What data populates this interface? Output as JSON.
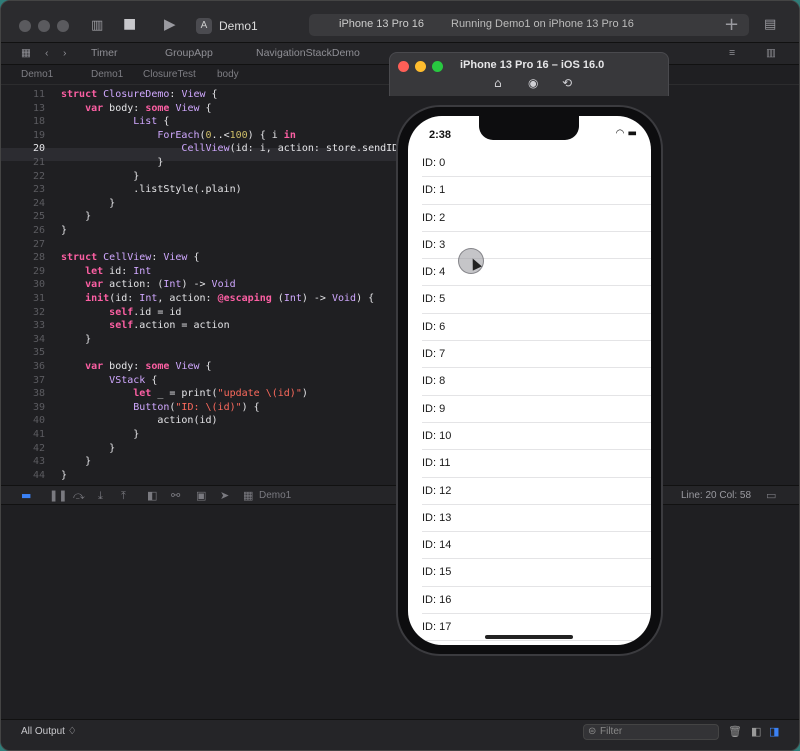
{
  "titlebar": {
    "app_name": "Demo1",
    "device": "iPhone 13 Pro 16",
    "status": "Running Demo1 on iPhone 13 Pro 16"
  },
  "tabs": [
    "Timer",
    "GroupApp",
    "NavigationStackDemo"
  ],
  "breadcrumb": [
    "Demo1",
    "Demo1",
    "ClosureTest",
    "body"
  ],
  "code": [
    {
      "n": "11",
      "t": "struct ClosureDemo: View {"
    },
    {
      "n": "13",
      "t": "    var body: some View {"
    },
    {
      "n": "18",
      "t": "            List {"
    },
    {
      "n": "19",
      "t": "                ForEach(0..<100) { i in"
    },
    {
      "n": "20",
      "t": "                    CellView(id: i, action: store.sendID)"
    },
    {
      "n": "21",
      "t": "                }"
    },
    {
      "n": "22",
      "t": "            }"
    },
    {
      "n": "23",
      "t": "            .listStyle(.plain)"
    },
    {
      "n": "24",
      "t": "        }"
    },
    {
      "n": "25",
      "t": "    }"
    },
    {
      "n": "26",
      "t": "}"
    },
    {
      "n": "27",
      "t": ""
    },
    {
      "n": "28",
      "t": "struct CellView: View {"
    },
    {
      "n": "29",
      "t": "    let id: Int"
    },
    {
      "n": "30",
      "t": "    var action: (Int) -> Void"
    },
    {
      "n": "31",
      "t": "    init(id: Int, action: @escaping (Int) -> Void) {"
    },
    {
      "n": "32",
      "t": "        self.id = id"
    },
    {
      "n": "33",
      "t": "        self.action = action"
    },
    {
      "n": "34",
      "t": "    }"
    },
    {
      "n": "35",
      "t": ""
    },
    {
      "n": "36",
      "t": "    var body: some View {"
    },
    {
      "n": "37",
      "t": "        VStack {"
    },
    {
      "n": "38",
      "t": "            let _ = print(\"update \\(id)\")"
    },
    {
      "n": "39",
      "t": "            Button(\"ID: \\(id)\") {"
    },
    {
      "n": "40",
      "t": "                action(id)"
    },
    {
      "n": "41",
      "t": "            }"
    },
    {
      "n": "42",
      "t": "        }"
    },
    {
      "n": "43",
      "t": "    }"
    },
    {
      "n": "44",
      "t": "}"
    }
  ],
  "debugbar": {
    "scheme": "Demo1",
    "position": "Line: 20  Col: 58"
  },
  "footer": {
    "output_label": "All Output ♢",
    "filter_placeholder": "Filter"
  },
  "simulator": {
    "title": "iPhone 13 Pro 16 – iOS 16.0",
    "time": "2:38",
    "rows": [
      "ID: 0",
      "ID: 1",
      "ID: 2",
      "ID: 3",
      "ID: 4",
      "ID: 5",
      "ID: 6",
      "ID: 7",
      "ID: 8",
      "ID: 9",
      "ID: 10",
      "ID: 11",
      "ID: 12",
      "ID: 13",
      "ID: 14",
      "ID: 15",
      "ID: 16",
      "ID: 17"
    ]
  }
}
